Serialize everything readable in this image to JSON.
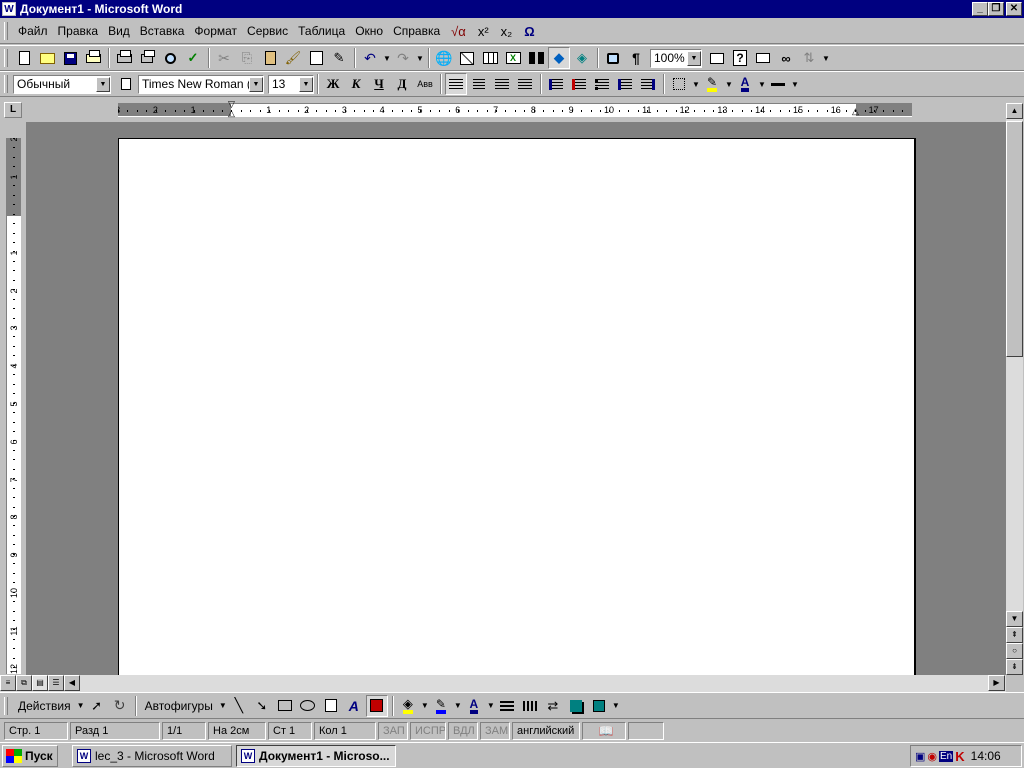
{
  "window": {
    "title": "Документ1 - Microsoft Word",
    "app_icon": "W"
  },
  "menu": {
    "items": [
      {
        "label": "Файл"
      },
      {
        "label": "Правка"
      },
      {
        "label": "Вид"
      },
      {
        "label": "Вставка"
      },
      {
        "label": "Формат"
      },
      {
        "label": "Сервис"
      },
      {
        "label": "Таблица"
      },
      {
        "label": "Окно"
      },
      {
        "label": "Справка"
      }
    ],
    "extra": [
      {
        "icon": "equation-icon",
        "glyph": "√α"
      },
      {
        "icon": "superscript-icon",
        "glyph": "x²"
      },
      {
        "icon": "subscript-icon",
        "glyph": "x₂"
      },
      {
        "icon": "omega-symbol-icon",
        "glyph": "Ω"
      }
    ]
  },
  "standard_toolbar": {
    "zoom": "100%",
    "pilcrow": "¶"
  },
  "format_toolbar": {
    "style": "Обычный",
    "font": "Times New Roman (Ct",
    "size": "13",
    "bold": "Ж",
    "italic": "К",
    "underline": "Ч",
    "strike": "Д",
    "caps": "Авв"
  },
  "ruler": {
    "horizontal": [
      "3",
      "2",
      "1",
      "1",
      "2",
      "3",
      "4",
      "5",
      "6",
      "7",
      "8",
      "9",
      "10",
      "11",
      "12",
      "13",
      "14",
      "15",
      "16",
      "17"
    ],
    "vertical": [
      "2",
      "1",
      "1",
      "2",
      "3",
      "4",
      "5",
      "6",
      "7",
      "8",
      "9",
      "10",
      "11",
      "12"
    ],
    "tab_selector": "L"
  },
  "drawing_toolbar": {
    "actions": "Действия",
    "autoshapes": "Автофигуры"
  },
  "status": {
    "page": "Стр. 1",
    "section": "Разд 1",
    "pages": "1/1",
    "at": "На 2см",
    "line": "Ст 1",
    "col": "Кол 1",
    "rec": "ЗАП",
    "trk": "ИСПР",
    "ext": "ВДЛ",
    "ovr": "ЗАМ",
    "lang": "английский"
  },
  "taskbar": {
    "start": "Пуск",
    "tasks": [
      {
        "label": "lec_3 - Microsoft Word",
        "active": false
      },
      {
        "label": "Документ1 - Microso...",
        "active": true
      }
    ],
    "lang": "En",
    "clock": "14:06"
  }
}
